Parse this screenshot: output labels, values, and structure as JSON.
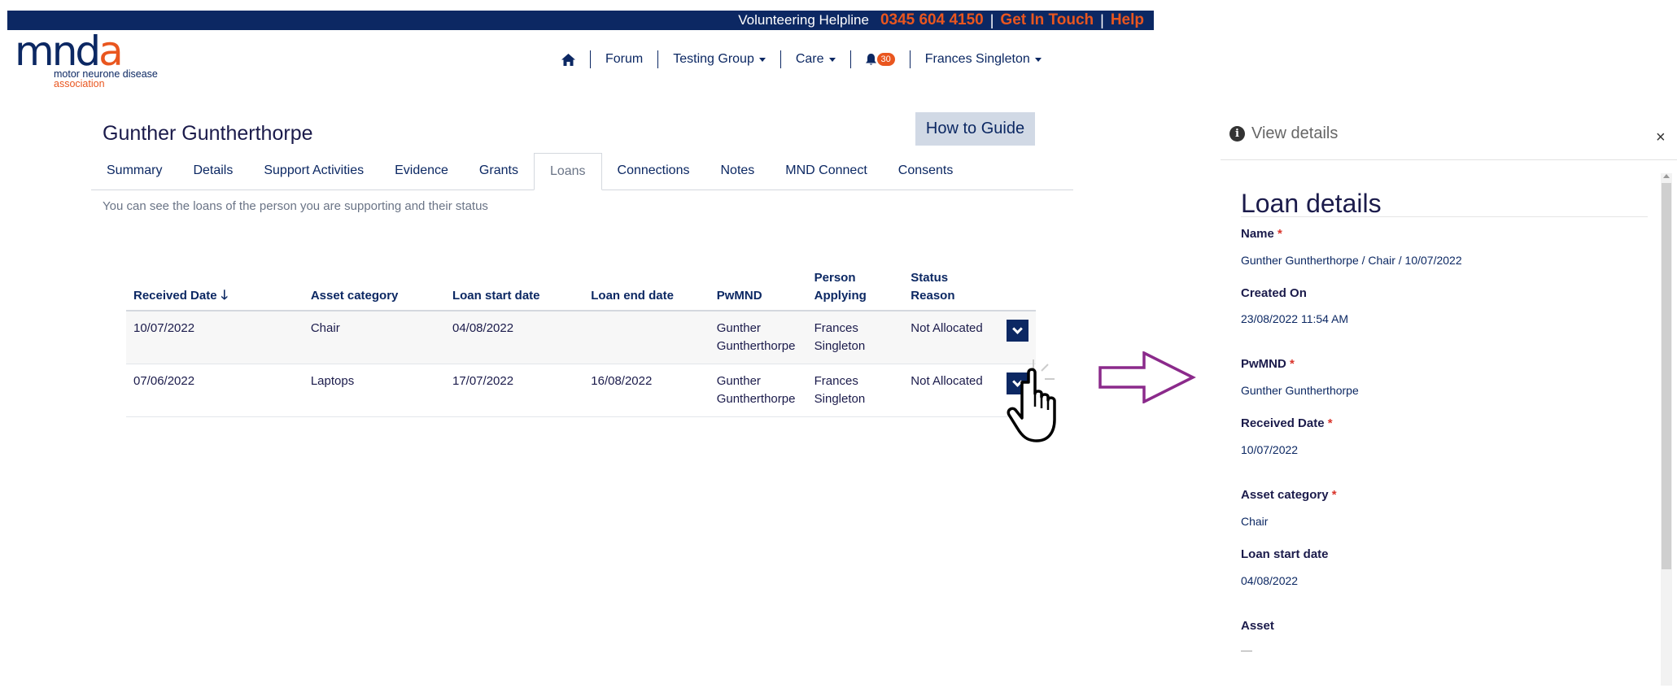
{
  "topbar": {
    "helpline_label": "Volunteering Helpline",
    "phone": "0345 604 4150",
    "sep": "|",
    "get_in_touch": "Get In Touch",
    "help": "Help"
  },
  "logo": {
    "mark_start": "mnd",
    "mark_end": "a",
    "line1": "motor neurone disease",
    "line2": "association"
  },
  "nav": {
    "home_icon": "home-icon",
    "forum": "Forum",
    "testing_group": "Testing Group",
    "care": "Care",
    "bell_icon": "bell-icon",
    "notifications": "30",
    "user": "Frances Singleton"
  },
  "page": {
    "person_name": "Gunther Guntherthorpe",
    "guide_button": "How to Guide",
    "subtitle": "You can see the loans of the person you are supporting and their status"
  },
  "tabs": [
    {
      "label": "Summary"
    },
    {
      "label": "Details"
    },
    {
      "label": "Support Activities"
    },
    {
      "label": "Evidence"
    },
    {
      "label": "Grants"
    },
    {
      "label": "Loans"
    },
    {
      "label": "Connections"
    },
    {
      "label": "Notes"
    },
    {
      "label": "MND Connect"
    },
    {
      "label": "Consents"
    }
  ],
  "table": {
    "headers": {
      "received": "Received Date",
      "sort_icon": "arrow-down-icon",
      "category": "Asset category",
      "start": "Loan start date",
      "end": "Loan end date",
      "pwmnd": "PwMND",
      "person_1": "Person",
      "person_2": "Applying",
      "status": "Status Reason"
    },
    "rows": [
      {
        "received": "10/07/2022",
        "category": "Chair",
        "start": "04/08/2022",
        "end": "",
        "pwmnd_1": "Gunther",
        "pwmnd_2": "Guntherthorpe",
        "person_1": "Frances",
        "person_2": "Singleton",
        "status": "Not Allocated"
      },
      {
        "received": "07/06/2022",
        "category": "Laptops",
        "start": "17/07/2022",
        "end": "16/08/2022",
        "pwmnd_1": "Gunther",
        "pwmnd_2": "Guntherthorpe",
        "person_1": "Frances",
        "person_2": "Singleton",
        "status": "Not Allocated"
      }
    ]
  },
  "panel": {
    "info_icon_glyph": "i",
    "title": "View details",
    "close": "×",
    "form_title": "Loan details",
    "required_mark": "*",
    "fields": {
      "name_label": "Name",
      "name_value": "Gunther Guntherthorpe / Chair / 10/07/2022",
      "created_label": "Created On",
      "created_value": "23/08/2022 11:54 AM",
      "pwmnd_label": "PwMND",
      "pwmnd_value": "Gunther Guntherthorpe",
      "received_label": "Received Date",
      "received_value": "10/07/2022",
      "category_label": "Asset category",
      "category_value": "Chair",
      "start_label": "Loan start date",
      "start_value": "04/08/2022",
      "asset_label": "Asset",
      "asset_value": "—"
    }
  },
  "colors": {
    "navy": "#0c2863",
    "orange": "#e9561f",
    "annotation_purple": "#8b2a8b"
  }
}
